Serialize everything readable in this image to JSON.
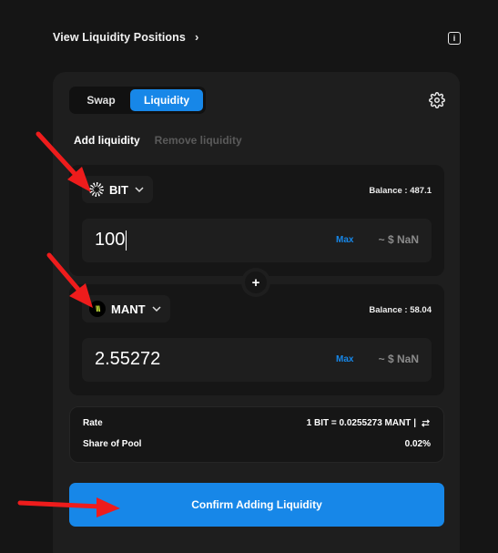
{
  "header": {
    "view_positions_label": "View Liquidity Positions",
    "chevron": "›",
    "info_icon": "info-icon"
  },
  "mode_toggle": {
    "swap_label": "Swap",
    "liquidity_label": "Liquidity"
  },
  "sub_tabs": {
    "add_label": "Add liquidity",
    "remove_label": "Remove liquidity"
  },
  "token_a": {
    "symbol": "BIT",
    "balance_label": "Balance : 487.1",
    "amount": "100",
    "max_label": "Max",
    "usd_value": "~ $ NaN"
  },
  "token_b": {
    "symbol": "MANT",
    "balance_label": "Balance : 58.04",
    "amount": "2.55272",
    "max_label": "Max",
    "usd_value": "~ $ NaN"
  },
  "plus_symbol": "+",
  "info": {
    "rate_label": "Rate",
    "rate_value": "1 BIT = 0.0255273 MANT  |",
    "share_label": "Share of Pool",
    "share_value": "0.02%"
  },
  "confirm_label": "Confirm Adding Liquidity",
  "colors": {
    "accent": "#1787e8",
    "arrow": "#ee1c1c"
  }
}
